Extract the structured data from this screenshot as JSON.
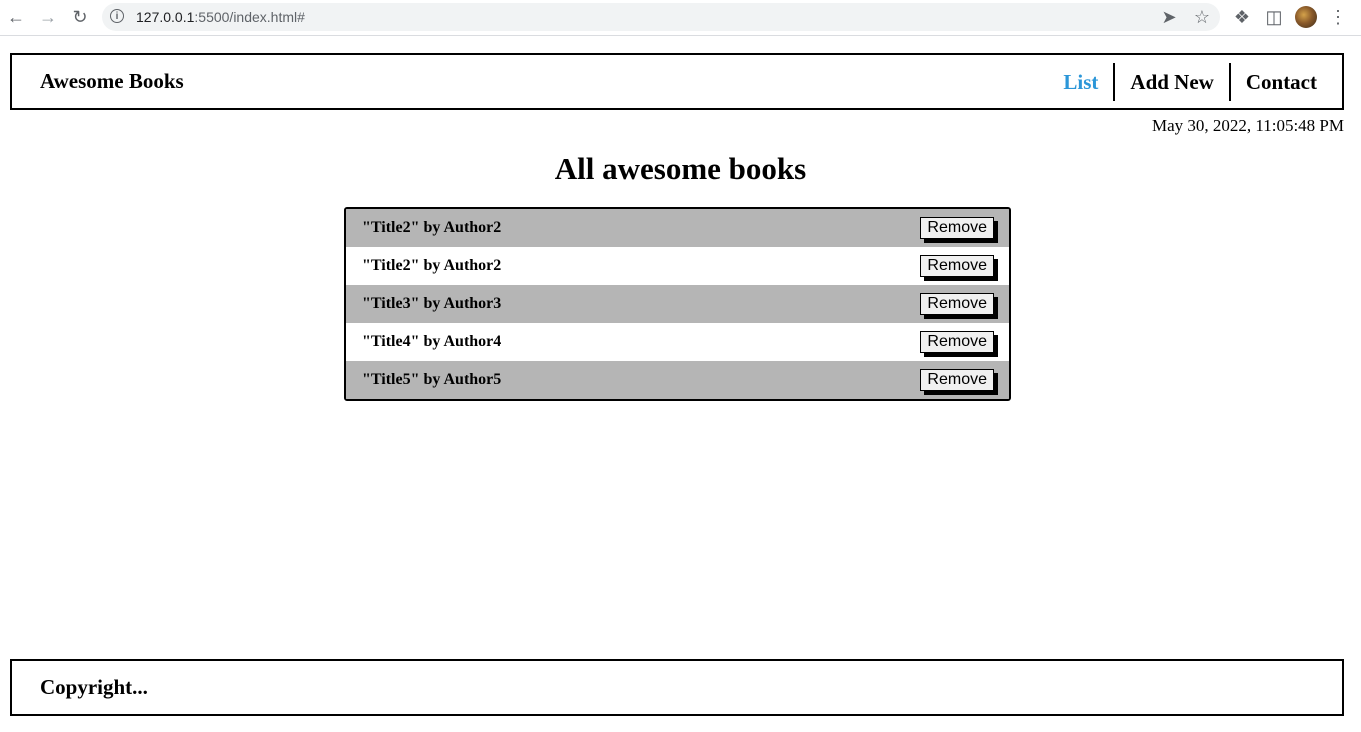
{
  "browser": {
    "url_host": "127.0.0.1",
    "url_rest": ":5500/index.html#"
  },
  "header": {
    "brand": "Awesome Books",
    "nav": [
      {
        "label": "List",
        "active": true
      },
      {
        "label": "Add New",
        "active": false
      },
      {
        "label": "Contact",
        "active": false
      }
    ]
  },
  "datetime": "May 30, 2022, 11:05:48 PM",
  "main": {
    "title": "All awesome books",
    "books": [
      {
        "text": "\"Title2\" by Author2",
        "button": "Remove"
      },
      {
        "text": "\"Title2\" by Author2",
        "button": "Remove"
      },
      {
        "text": "\"Title3\" by Author3",
        "button": "Remove"
      },
      {
        "text": "\"Title4\" by Author4",
        "button": "Remove"
      },
      {
        "text": "\"Title5\" by Author5",
        "button": "Remove"
      }
    ]
  },
  "footer": {
    "text": "Copyright..."
  },
  "colors": {
    "active_nav": "#2b96d8",
    "row_alt": "#b5b5b5"
  }
}
